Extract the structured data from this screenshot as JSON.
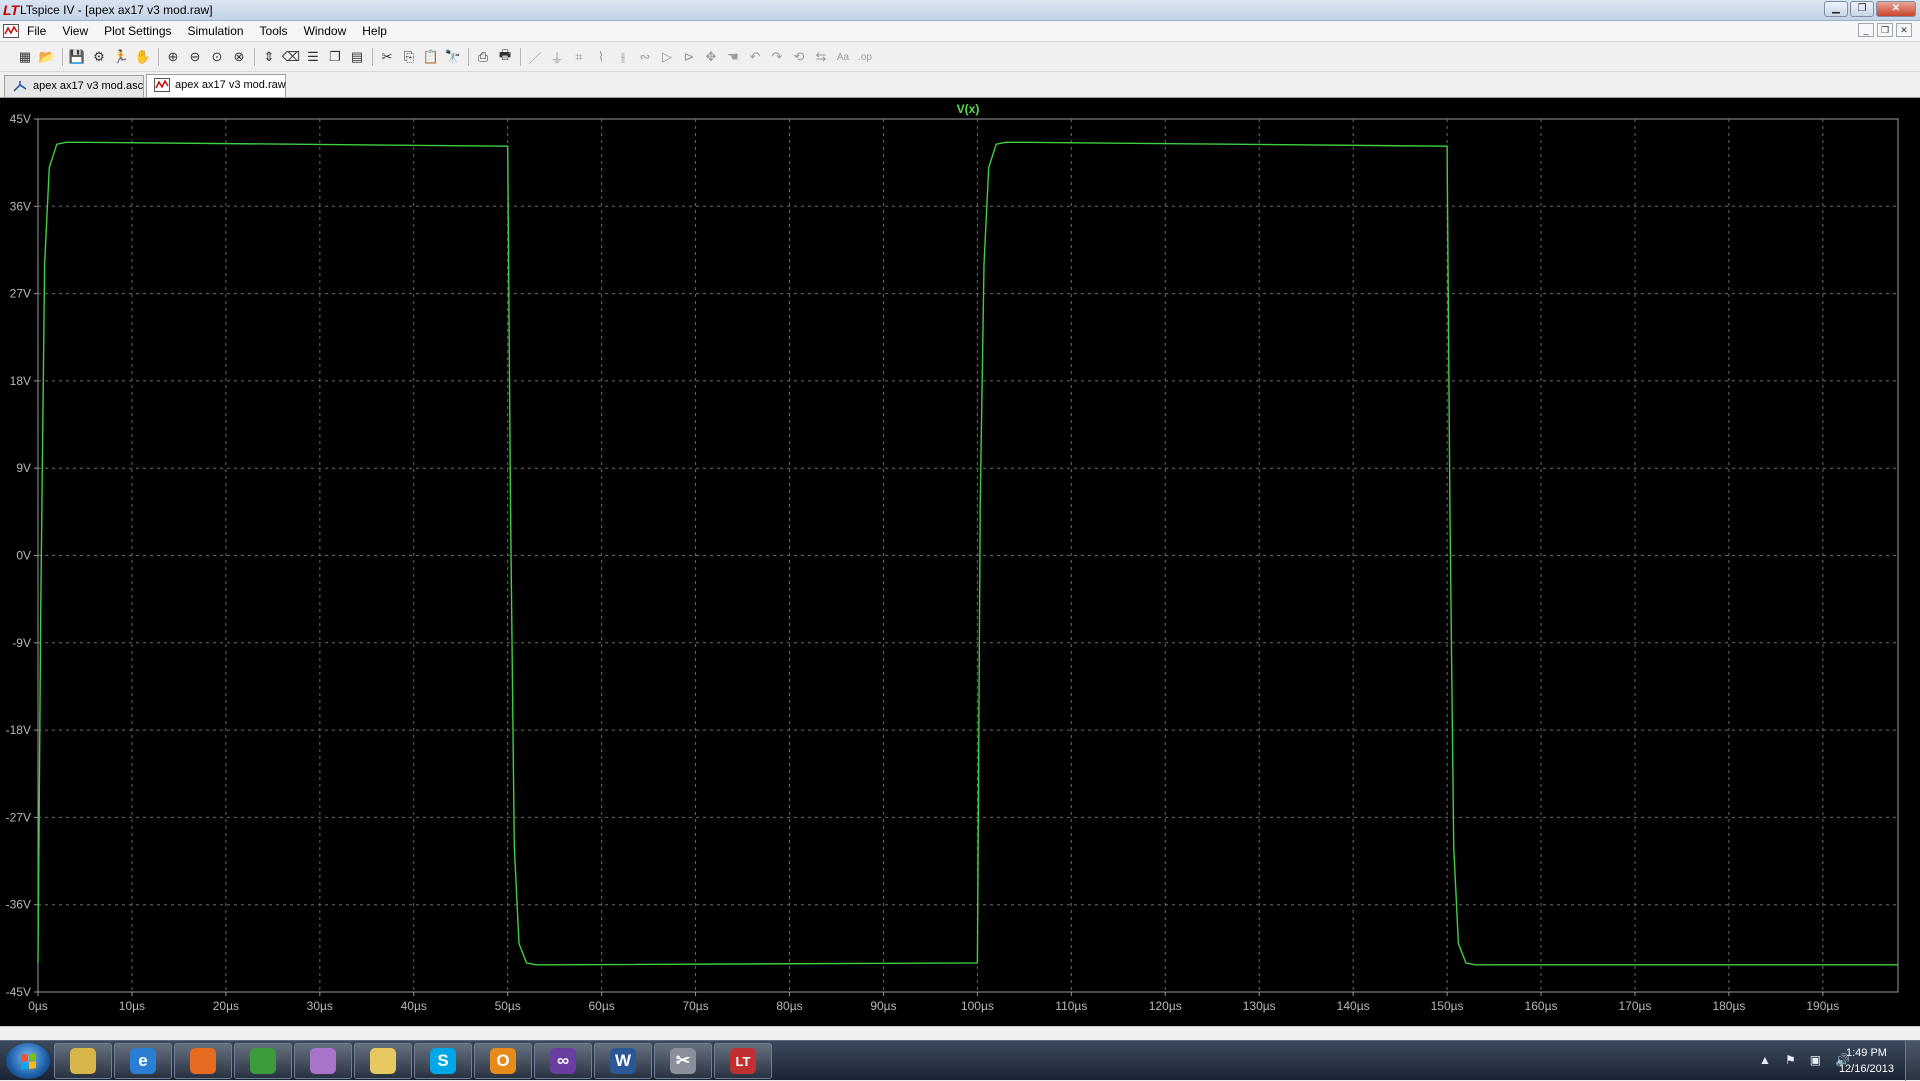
{
  "window": {
    "title": "LTspice IV - [apex ax17 v3 mod.raw]",
    "icon": "ltspice-app-icon"
  },
  "menu": {
    "items": [
      "File",
      "View",
      "Plot Settings",
      "Simulation",
      "Tools",
      "Window",
      "Help"
    ]
  },
  "toolbar": {
    "icons": [
      "new-schematic-icon",
      "open-icon",
      "save-icon",
      "control-panel-icon",
      "run-icon",
      "halt-icon",
      "zoom-in-icon",
      "zoom-out-icon",
      "zoom-fit-icon",
      "zoom-cancel-icon",
      "autorange-icon",
      "delete-trace-icon",
      "tile-horizontal-icon",
      "cascade-icon",
      "tile-icon",
      "cut-icon",
      "copy-icon",
      "paste-icon",
      "find-icon",
      "print-setup-icon",
      "print-icon",
      "wire-icon",
      "ground-icon",
      "label-icon",
      "resistor-icon",
      "capacitor-icon",
      "inductor-icon",
      "diode-icon",
      "component-icon",
      "move-icon",
      "drag-icon",
      "undo-icon",
      "redo-icon",
      "rotate-icon",
      "mirror-icon",
      "text-icon",
      "spice-directive-icon"
    ]
  },
  "tabs": [
    {
      "label": "apex ax17 v3 mod.asc",
      "active": false,
      "icon": "schematic-tab-icon"
    },
    {
      "label": "apex ax17 v3 mod.raw",
      "active": true,
      "icon": "waveform-tab-icon"
    }
  ],
  "chart_data": {
    "type": "line",
    "title": "",
    "xlabel": "",
    "ylabel": "",
    "series": [
      {
        "name": "V(x)",
        "color": "#3fcf3f",
        "x": [
          0,
          0.3,
          0.7,
          1.2,
          2.0,
          3.0,
          5.0,
          50.0,
          50.3,
          50.7,
          51.2,
          52.0,
          53.0,
          55.0,
          100.0,
          100.3,
          100.7,
          101.2,
          102.0,
          103.0,
          105.0,
          150.0,
          150.3,
          150.7,
          151.2,
          152.0,
          153.0,
          155.0,
          198.0
        ],
        "y": [
          -42.0,
          -5.0,
          30.0,
          40.0,
          42.4,
          42.6,
          42.6,
          42.2,
          5.0,
          -30.0,
          -40.0,
          -42.0,
          -42.2,
          -42.2,
          -42.0,
          5.0,
          30.0,
          40.0,
          42.4,
          42.6,
          42.6,
          42.2,
          5.0,
          -30.0,
          -40.0,
          -42.0,
          -42.2,
          -42.2,
          -42.2
        ]
      }
    ],
    "x_ticks": [
      "0µs",
      "10µs",
      "20µs",
      "30µs",
      "40µs",
      "50µs",
      "60µs",
      "70µs",
      "80µs",
      "90µs",
      "100µs",
      "110µs",
      "120µs",
      "130µs",
      "140µs",
      "150µs",
      "160µs",
      "170µs",
      "180µs",
      "190µs"
    ],
    "y_ticks": [
      "45V",
      "36V",
      "27V",
      "18V",
      "9V",
      "0V",
      "-9V",
      "-18V",
      "-27V",
      "-36V",
      "-45V"
    ],
    "xlim": [
      0,
      198
    ],
    "ylim": [
      -45,
      45
    ],
    "grid": true,
    "background": "#000000"
  },
  "taskbar": {
    "apps": [
      {
        "name": "explorer-icon",
        "color": "#d9b64a",
        "glyph": ""
      },
      {
        "name": "internet-explorer-icon",
        "color": "#2a7fd4",
        "glyph": "e"
      },
      {
        "name": "firefox-icon",
        "color": "#e66a1f",
        "glyph": ""
      },
      {
        "name": "chrome-icon",
        "color": "#3a9c3a",
        "glyph": ""
      },
      {
        "name": "paint-icon",
        "color": "#a974c9",
        "glyph": ""
      },
      {
        "name": "folder-icon",
        "color": "#e8c860",
        "glyph": ""
      },
      {
        "name": "skype-icon",
        "color": "#00a7e7",
        "glyph": "S"
      },
      {
        "name": "outlook-icon",
        "color": "#e68a1a",
        "glyph": "O"
      },
      {
        "name": "visual-studio-icon",
        "color": "#6a3ea1",
        "glyph": "∞"
      },
      {
        "name": "word-icon",
        "color": "#2b5797",
        "glyph": "W"
      },
      {
        "name": "tools-icon",
        "color": "#8a8f99",
        "glyph": "✂"
      },
      {
        "name": "ltspice-icon",
        "color": "#c03030",
        "glyph": "LT"
      }
    ],
    "clock_time": "1:49 PM",
    "clock_date": "12/16/2013"
  }
}
